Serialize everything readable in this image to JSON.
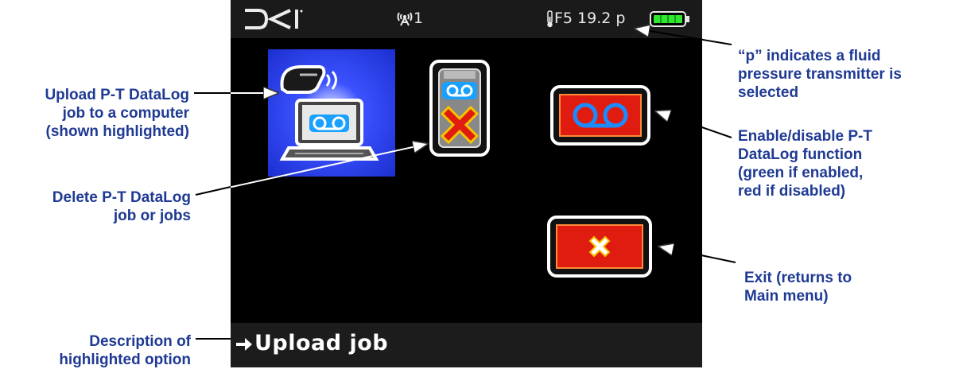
{
  "device": {
    "logo": "DCI",
    "status": {
      "signal_icon": "antenna-icon",
      "channel": "1",
      "thermometer_icon": "thermometer-icon",
      "frequency": "F5 19.2 p",
      "battery_icon": "battery-icon"
    },
    "menu_icons": [
      {
        "name": "upload-job-icon",
        "highlighted": true
      },
      {
        "name": "delete-job-icon",
        "highlighted": false
      },
      {
        "name": "datalog-toggle-icon",
        "highlighted": false,
        "state_color": "red"
      },
      {
        "name": "exit-icon",
        "highlighted": false
      }
    ],
    "description": "Upload job"
  },
  "callouts": {
    "upload": "Upload P-T DataLog job to a computer (shown highlighted)",
    "upload_lines": [
      "Upload P-T DataLog",
      "job to a computer",
      "(shown highlighted)"
    ],
    "delete_lines": [
      "Delete P-T DataLog",
      "job or jobs"
    ],
    "description_lines": [
      "Description of",
      "highlighted option"
    ],
    "p_lines": [
      "“p” indicates a fluid",
      "pressure transmitter is",
      "selected"
    ],
    "enable_lines": [
      "Enable/disable P-T",
      "DataLog function",
      "(green if enabled,",
      "red if disabled)"
    ],
    "exit_lines": [
      "Exit (returns to",
      "Main menu)"
    ]
  },
  "colors": {
    "callout_text": "#1f3a93",
    "highlight": "#1c2fd0",
    "datalog_red": "#e01c10",
    "battery_green": "#2ee82e"
  }
}
